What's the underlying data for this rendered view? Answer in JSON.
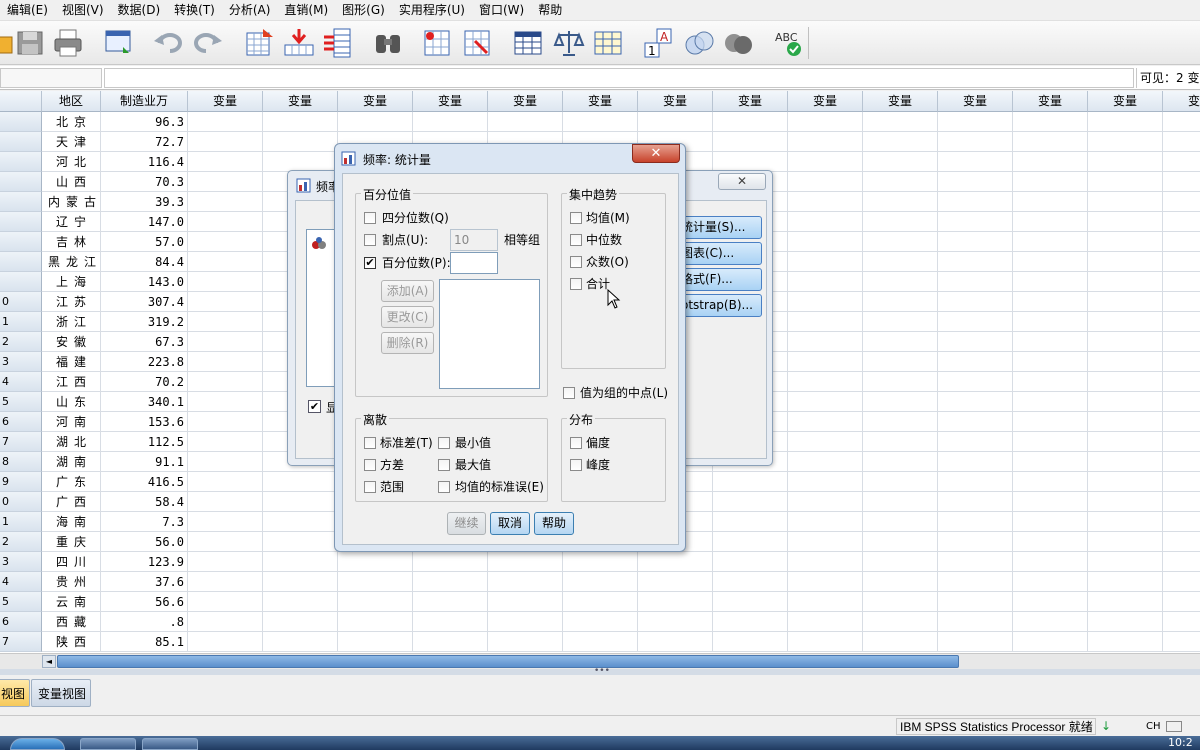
{
  "menu": [
    "编辑(E)",
    "视图(V)",
    "数据(D)",
    "转换(T)",
    "分析(A)",
    "直销(M)",
    "图形(G)",
    "实用程序(U)",
    "窗口(W)",
    "帮助"
  ],
  "editor": {
    "visible": "可见：2 变"
  },
  "grid": {
    "headers": {
      "region": "地区",
      "value": "制造业万",
      "var": "变量"
    },
    "rownums": [
      "",
      "",
      "",
      "",
      "",
      "",
      "",
      "",
      "",
      "0",
      "1",
      "2",
      "3",
      "4",
      "5",
      "6",
      "7",
      "8",
      "9",
      "0",
      "1",
      "2",
      "3",
      "4",
      "5",
      "6",
      "7"
    ],
    "rows": [
      {
        "region": "北京",
        "value": "96.3"
      },
      {
        "region": "天津",
        "value": "72.7"
      },
      {
        "region": "河北",
        "value": "116.4"
      },
      {
        "region": "山西",
        "value": "70.3"
      },
      {
        "region": "内蒙古",
        "value": "39.3"
      },
      {
        "region": "辽宁",
        "value": "147.0"
      },
      {
        "region": "吉林",
        "value": "57.0"
      },
      {
        "region": "黑龙江",
        "value": "84.4"
      },
      {
        "region": "上海",
        "value": "143.0"
      },
      {
        "region": "江苏",
        "value": "307.4"
      },
      {
        "region": "浙江",
        "value": "319.2"
      },
      {
        "region": "安徽",
        "value": "67.3"
      },
      {
        "region": "福建",
        "value": "223.8"
      },
      {
        "region": "江西",
        "value": "70.2"
      },
      {
        "region": "山东",
        "value": "340.1"
      },
      {
        "region": "河南",
        "value": "153.6"
      },
      {
        "region": "湖北",
        "value": "112.5"
      },
      {
        "region": "湖南",
        "value": "91.1"
      },
      {
        "region": "广东",
        "value": "416.5"
      },
      {
        "region": "广西",
        "value": "58.4"
      },
      {
        "region": "海南",
        "value": "7.3"
      },
      {
        "region": "重庆",
        "value": "56.0"
      },
      {
        "region": "四川",
        "value": "123.9"
      },
      {
        "region": "贵州",
        "value": "37.6"
      },
      {
        "region": "云南",
        "value": "56.6"
      },
      {
        "region": "西藏",
        "value": ".8"
      },
      {
        "region": "陕西",
        "value": "85.1"
      }
    ]
  },
  "tabs": {
    "data_view": "视图",
    "variable_view": "变量视图"
  },
  "status": {
    "text": "IBM SPSS Statistics Processor 就绪",
    "ime": "CH",
    "clock": "10:2"
  },
  "bg_dialog": {
    "title": "频率",
    "close": "✕",
    "buttons": [
      "统计量(S)...",
      "图表(C)...",
      "格式(F)...",
      "otstrap(B)..."
    ],
    "show_label": "显"
  },
  "dialog": {
    "title": "频率: 统计量",
    "close": "✕",
    "percentile": {
      "legend": "百分位值",
      "quartiles": "四分位数(Q)",
      "cutpoints": "割点(U):",
      "cutpoints_value": "10",
      "equal_groups": "相等组",
      "percentiles": "百分位数(P):",
      "add": "添加(A)",
      "change": "更改(C)",
      "remove": "删除(R)"
    },
    "central": {
      "legend": "集中趋势",
      "mean": "均值(M)",
      "median": "中位数",
      "mode": "众数(O)",
      "sum": "合计"
    },
    "midpoints": "值为组的中点(L)",
    "dispersion": {
      "legend": "离散",
      "std": "标准差(T)",
      "min": "最小值",
      "variance": "方差",
      "max": "最大值",
      "range": "范围",
      "se": "均值的标准误(E)"
    },
    "distribution": {
      "legend": "分布",
      "skewness": "偏度",
      "kurtosis": "峰度"
    },
    "buttons": {
      "continue": "继续",
      "cancel": "取消",
      "help": "帮助"
    }
  },
  "colors": {
    "accent": "#4a80c4",
    "close_red": "#c7432c",
    "scroll": "#5b8fcc"
  }
}
